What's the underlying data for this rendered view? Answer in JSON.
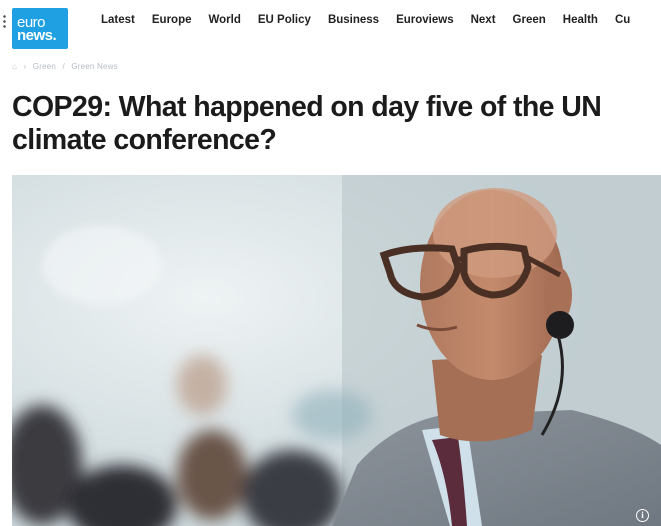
{
  "logo": {
    "line1": "euro",
    "line2": "news."
  },
  "nav": {
    "items": [
      "Latest",
      "Europe",
      "World",
      "EU Policy",
      "Business",
      "Euroviews",
      "Next",
      "Green",
      "Health",
      "Cu"
    ]
  },
  "breadcrumb": [
    "Green",
    "Green News"
  ],
  "article": {
    "headline": "COP29: What happened on day five of the UN climate conference?"
  },
  "hero": {
    "info_icon": "info-icon"
  },
  "colors": {
    "brand": "#1fa0e3",
    "text": "#1b1b1b"
  }
}
